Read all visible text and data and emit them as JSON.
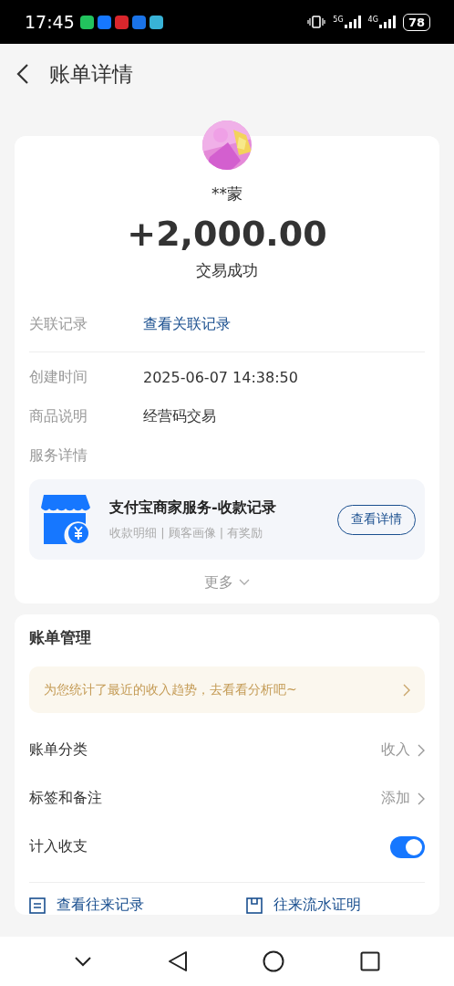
{
  "status_bar": {
    "time": "17:45",
    "apps": [
      {
        "color": "#22c35e"
      },
      {
        "color": "#1677ff"
      },
      {
        "color": "#d9262c"
      },
      {
        "color": "#1a73e8"
      },
      {
        "color": "#38b2d6"
      }
    ],
    "networks": [
      "5G",
      "4G"
    ],
    "battery": "78"
  },
  "header": {
    "title": "账单详情"
  },
  "summary": {
    "name": "**蒙",
    "amount": "+2,000.00",
    "status": "交易成功"
  },
  "details": [
    {
      "kind": "link",
      "label": "关联记录",
      "value": "查看关联记录"
    },
    {
      "kind": "divider"
    },
    {
      "kind": "text",
      "label": "创建时间",
      "value": "2025-06-07 14:38:50"
    },
    {
      "kind": "text",
      "label": "商品说明",
      "value": "经营码交易"
    },
    {
      "kind": "text",
      "label": "服务详情"
    }
  ],
  "service": {
    "title": "支付宝商家服务-收款记录",
    "subtitle": "收款明细 | 顾客画像 | 有奖励",
    "button": "查看详情"
  },
  "more": {
    "label": "更多",
    "expanded": false
  },
  "management": {
    "title": "账单管理",
    "banner": "为您统计了最近的收入趋势，去看看分析吧~",
    "rows": [
      {
        "kind": "nav",
        "label": "账单分类",
        "value": "收入"
      },
      {
        "kind": "nav",
        "label": "标签和备注",
        "value": "添加"
      },
      {
        "kind": "toggle",
        "label": "计入收支",
        "on": true
      }
    ],
    "links": [
      "查看往来记录",
      "往来流水证明"
    ]
  }
}
